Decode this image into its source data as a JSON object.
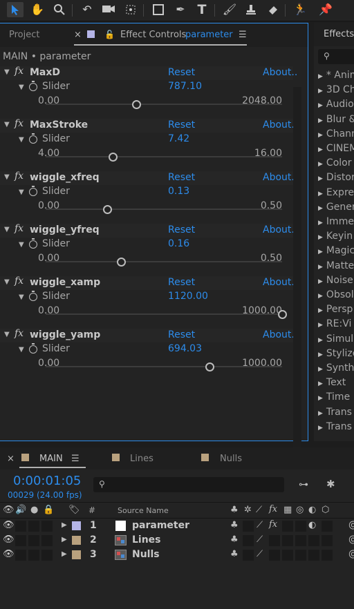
{
  "toolbar": {
    "tools": [
      "selection-tool",
      "hand-tool",
      "zoom-tool",
      "rotate-tool",
      "camera-tool",
      "pan-behind-tool",
      "rectangle-tool",
      "pen-tool",
      "type-tool",
      "brush-tool",
      "clone-stamp-tool",
      "eraser-tool",
      "puppet-tool",
      "pin-tool"
    ]
  },
  "left_panel": {
    "tab_project": "Project",
    "tab_effect_controls": "Effect Controls",
    "tab_layer": "parameter",
    "header": "MAIN • parameter",
    "reset_label": "Reset",
    "about_label": "About..",
    "slider_label": "Slider",
    "effects": [
      {
        "name": "MaxD",
        "value": "787.10",
        "min": "0.00",
        "max": "2048.00",
        "fraction": 0.3843
      },
      {
        "name": "MaxStroke",
        "value": "7.42",
        "min": "4.00",
        "max": "16.00",
        "fraction": 0.285
      },
      {
        "name": "wiggle_xfreq",
        "value": "0.13",
        "min": "0.00",
        "max": "0.50",
        "fraction": 0.26
      },
      {
        "name": "wiggle_yfreq",
        "value": "0.16",
        "min": "0.00",
        "max": "0.50",
        "fraction": 0.32
      },
      {
        "name": "wiggle_xamp",
        "value": "1120.00",
        "min": "0.00",
        "max": "1000.00",
        "fraction": 1.0
      },
      {
        "name": "wiggle_yamp",
        "value": "694.03",
        "min": "0.00",
        "max": "1000.00",
        "fraction": 0.694
      }
    ]
  },
  "right_panel": {
    "title": "Effects",
    "items": [
      "* Anim",
      "3D Ch",
      "Audio",
      "Blur &",
      "Chann",
      "CINEM",
      "Color",
      "Distor",
      "Expre",
      "Gener",
      "Imme",
      "Keyin",
      "Magic",
      "Matte",
      "Noise",
      "Obsol",
      "Persp",
      "RE:Vi",
      "Simul",
      "Stylize",
      "Synth",
      "Text",
      "Time",
      "Trans",
      "Trans"
    ]
  },
  "timeline": {
    "tabs": [
      {
        "label": "MAIN",
        "color": "#b9a17e"
      },
      {
        "label": "Lines",
        "color": "#b9a17e"
      },
      {
        "label": "Nulls",
        "color": "#b9a17e"
      }
    ],
    "timecode": "0:00:01:05",
    "frame_info": "00029 (24.00 fps)",
    "col_hash": "#",
    "col_source": "Source Name",
    "layers": [
      {
        "num": "1",
        "name": "parameter",
        "label_color": "#b4b4e6",
        "type": "solid"
      },
      {
        "num": "2",
        "name": "Lines",
        "label_color": "#b9a17e",
        "type": "comp"
      },
      {
        "num": "3",
        "name": "Nulls",
        "label_color": "#b9a17e",
        "type": "comp"
      }
    ]
  }
}
